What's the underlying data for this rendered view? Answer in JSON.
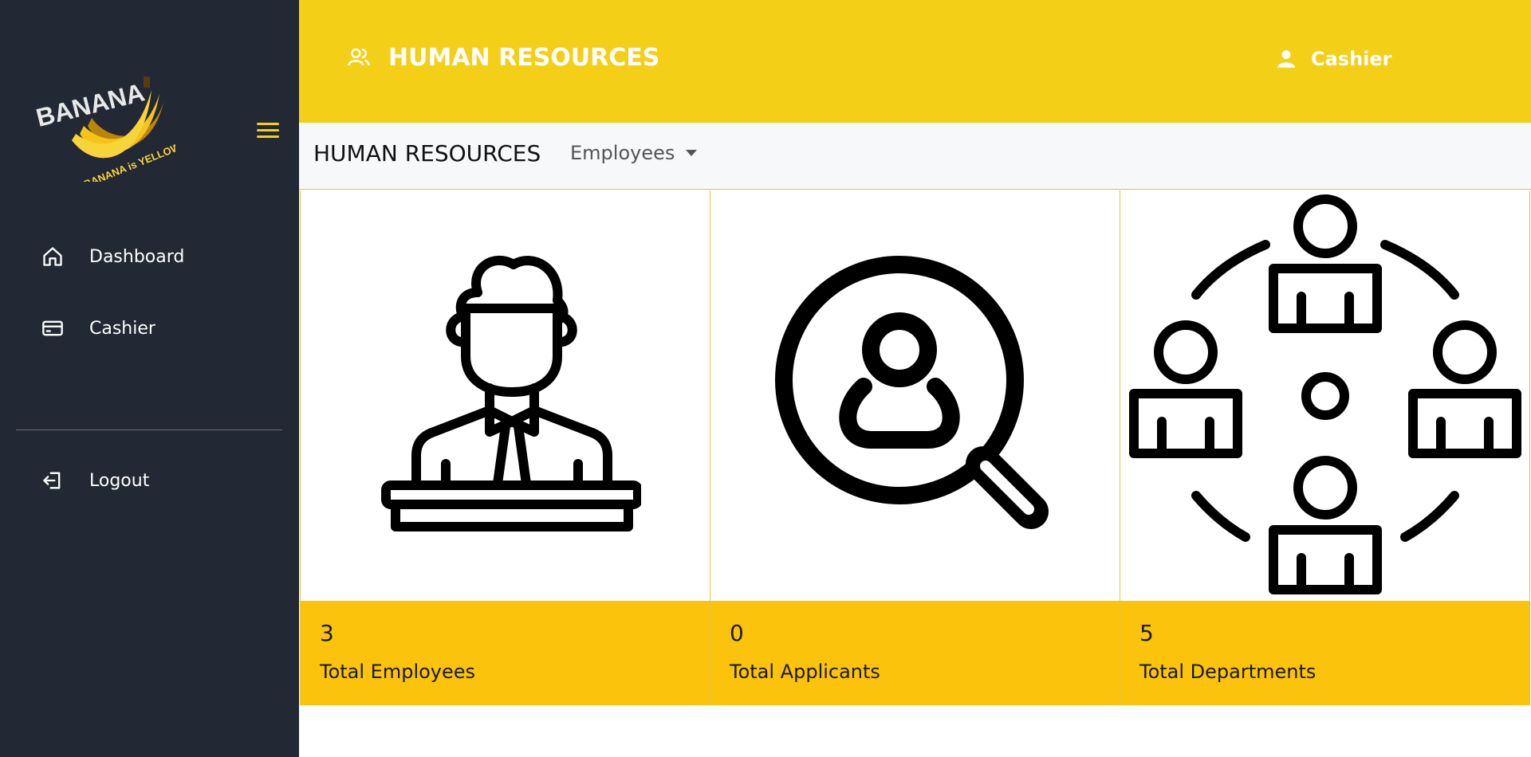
{
  "brand": {
    "logo_top": "BANANA",
    "logo_bottom": "BANANA is YELLOW!"
  },
  "sidebar": {
    "items": [
      {
        "label": "Dashboard",
        "icon": "home-icon"
      },
      {
        "label": "Cashier",
        "icon": "credit-card-icon"
      }
    ],
    "logout_label": "Logout"
  },
  "header": {
    "title": "HUMAN RESOURCES",
    "user_label": "Cashier"
  },
  "subbar": {
    "title": "HUMAN RESOURCES",
    "dropdown_label": "Employees"
  },
  "cards": [
    {
      "count": "3",
      "label": "Total Employees",
      "icon": "employee-icon"
    },
    {
      "count": "0",
      "label": "Total Applicants",
      "icon": "applicant-search-icon"
    },
    {
      "count": "5",
      "label": "Total Departments",
      "icon": "department-network-icon"
    }
  ],
  "colors": {
    "sidebar_bg": "#222834",
    "header_bg": "#f4cf17",
    "card_footer_bg": "#fbc30b",
    "accent": "#f4cf17"
  }
}
